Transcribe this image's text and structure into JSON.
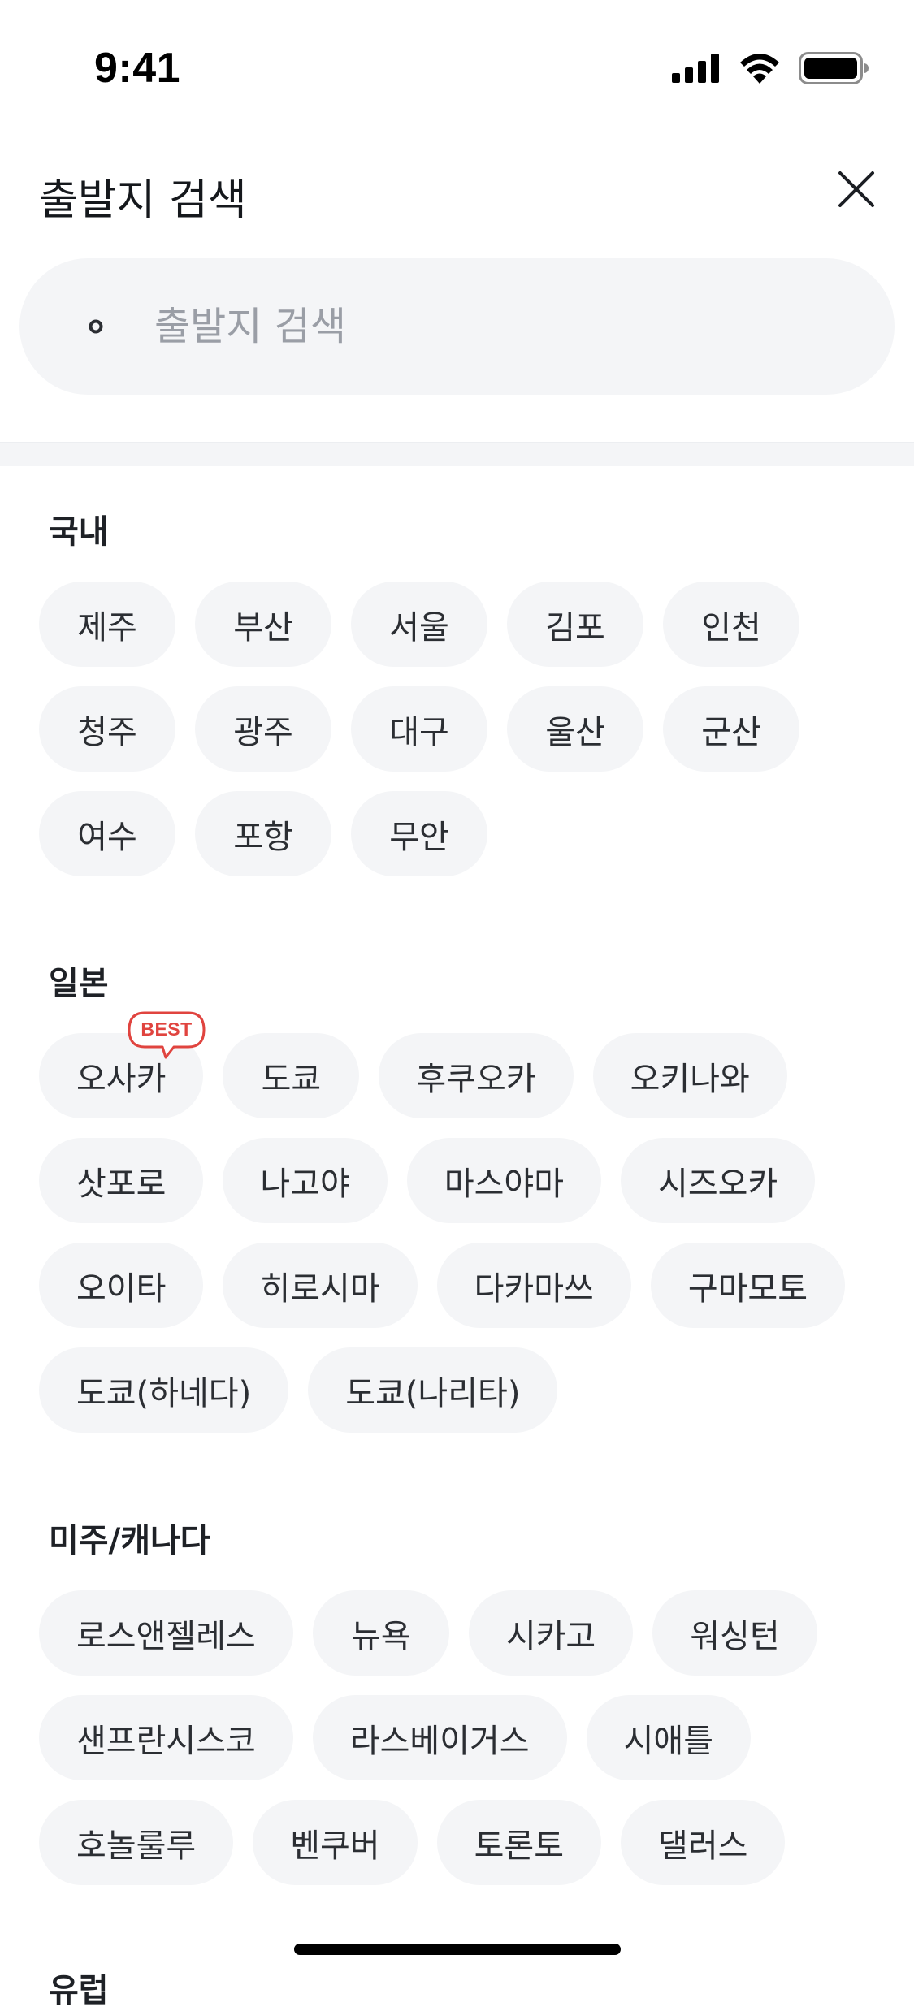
{
  "status_bar": {
    "time": "9:41"
  },
  "header": {
    "title": "출발지 검색"
  },
  "search": {
    "placeholder": "출발지 검색"
  },
  "sections": [
    {
      "title": "국내",
      "cities": [
        "제주",
        "부산",
        "서울",
        "김포",
        "인천",
        "청주",
        "광주",
        "대구",
        "울산",
        "군산",
        "여수",
        "포항",
        "무안"
      ]
    },
    {
      "title": "일본",
      "cities": [
        "오사카",
        "도쿄",
        "후쿠오카",
        "오키나와",
        "삿포로",
        "나고야",
        "마스야마",
        "시즈오카",
        "오이타",
        "히로시마",
        "다카마쓰",
        "구마모토",
        "도쿄(하네다)",
        "도쿄(나리타)"
      ],
      "badge": {
        "city_index": 0,
        "label": "BEST"
      }
    },
    {
      "title": "미주/캐나다",
      "cities": [
        "로스앤젤레스",
        "뉴욕",
        "시카고",
        "워싱턴",
        "샌프란시스코",
        "라스베이거스",
        "시애틀",
        "호놀룰루",
        "벤쿠버",
        "토론토",
        "댈러스"
      ]
    }
  ],
  "next_section_peek": "유럽",
  "icons": {
    "signal": "signal-icon",
    "wifi": "wifi-icon",
    "battery": "battery-icon",
    "close": "close-icon",
    "search": "search-icon"
  },
  "colors": {
    "chip_bg": "#f4f5f7",
    "badge": "#e0443f",
    "text": "#1b1e23",
    "placeholder": "#9a9ea6"
  }
}
